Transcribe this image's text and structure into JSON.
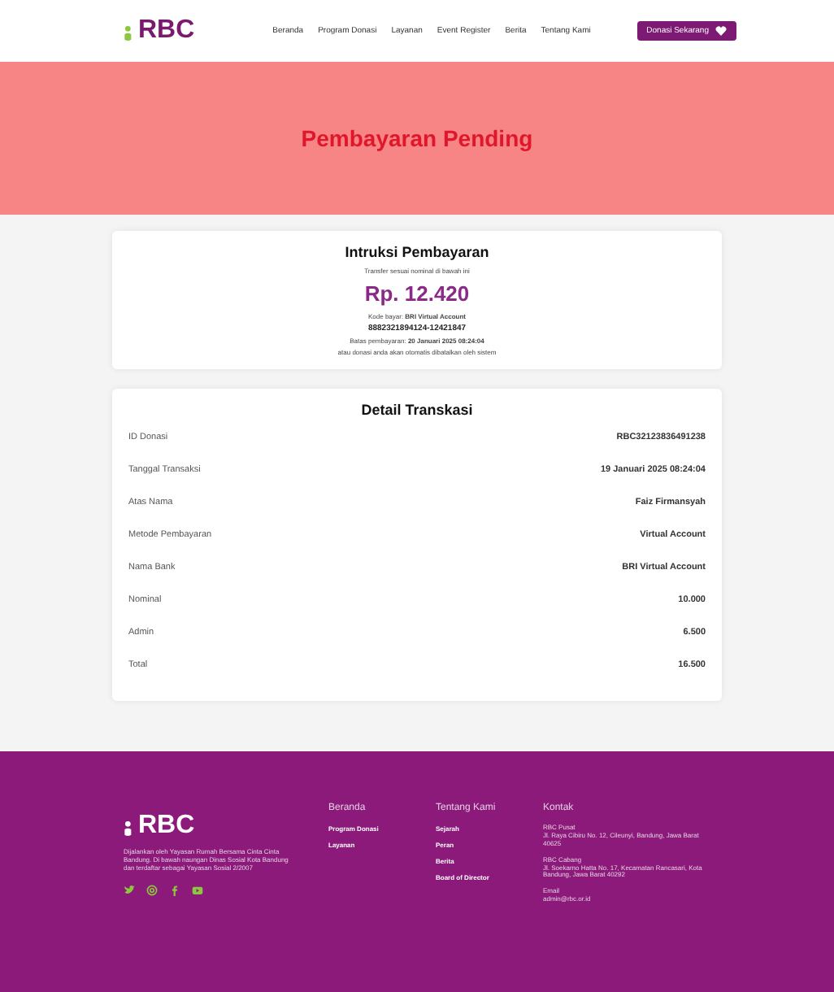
{
  "header": {
    "logo": "RBC",
    "nav": [
      "Beranda",
      "Program Donasi",
      "Layanan",
      "Event Register",
      "Berita",
      "Tentang Kami"
    ],
    "cta": "Donasi Sekarang"
  },
  "banner": {
    "title": "Pembayaran Pending"
  },
  "instruction": {
    "title": "Intruksi Pembayaran",
    "subtitle": "Transfer sesuai nominal di bawah ini",
    "amount": "Rp. 12.420",
    "method": "Kode bayar: **BRI Virtual Account**",
    "account": "8882321894124-12421847",
    "deadline": "Batas pembayaran: **20 Januari 2025 08:24:04**",
    "note": "atau donasi anda akan otomatis dibatalkan oleh sistem"
  },
  "detail": {
    "title": "Detail Transkasi",
    "rows": [
      {
        "label": "ID Donasi",
        "value": "RBC32123836491238"
      },
      {
        "label": "Tanggal Transaksi",
        "value": "19 Januari 2025 08:24:04"
      },
      {
        "label": "Atas Nama",
        "value": "Faiz Firmansyah"
      },
      {
        "label": "Metode Pembayaran",
        "value": "Virtual Account"
      },
      {
        "label": "Nama Bank",
        "value": "BRI Virtual Account"
      },
      {
        "label": "Nominal",
        "value": "10.000"
      },
      {
        "label": "Admin",
        "value": "6.500"
      },
      {
        "label": "Total",
        "value": "16.500"
      }
    ]
  },
  "footer": {
    "logo": "RBC",
    "description": "Dijalankan oleh Yayasan Rumah Bersama Cinta Cinta Bandung. Di bawah naungan Dinas Sosial Kota Bandung dan terdaftar sebagai Yayasan Sosial 2/2007",
    "columns": [
      {
        "title": "Beranda",
        "links": [
          "Program Donasi",
          "Layanan"
        ]
      },
      {
        "title": "Tentang Kami",
        "links": [
          "Sejarah",
          "Peran",
          "Berita",
          "Board of Director"
        ]
      }
    ],
    "contact": {
      "title": "Kontak",
      "blocks": [
        {
          "name": "RBC Pusat",
          "text": "Jl. Raya Cibiru No. 12, Cileunyi, Bandung, Jawa Barat 40625"
        },
        {
          "name": "RBC Cabang",
          "text": "Jl. Soekarno Hatta No. 17, Kecamatan Rancasari, Kota Bandung, Jawa Barat 40292"
        },
        {
          "name": "Email",
          "text": "admin@rbc.or.id"
        }
      ]
    }
  }
}
